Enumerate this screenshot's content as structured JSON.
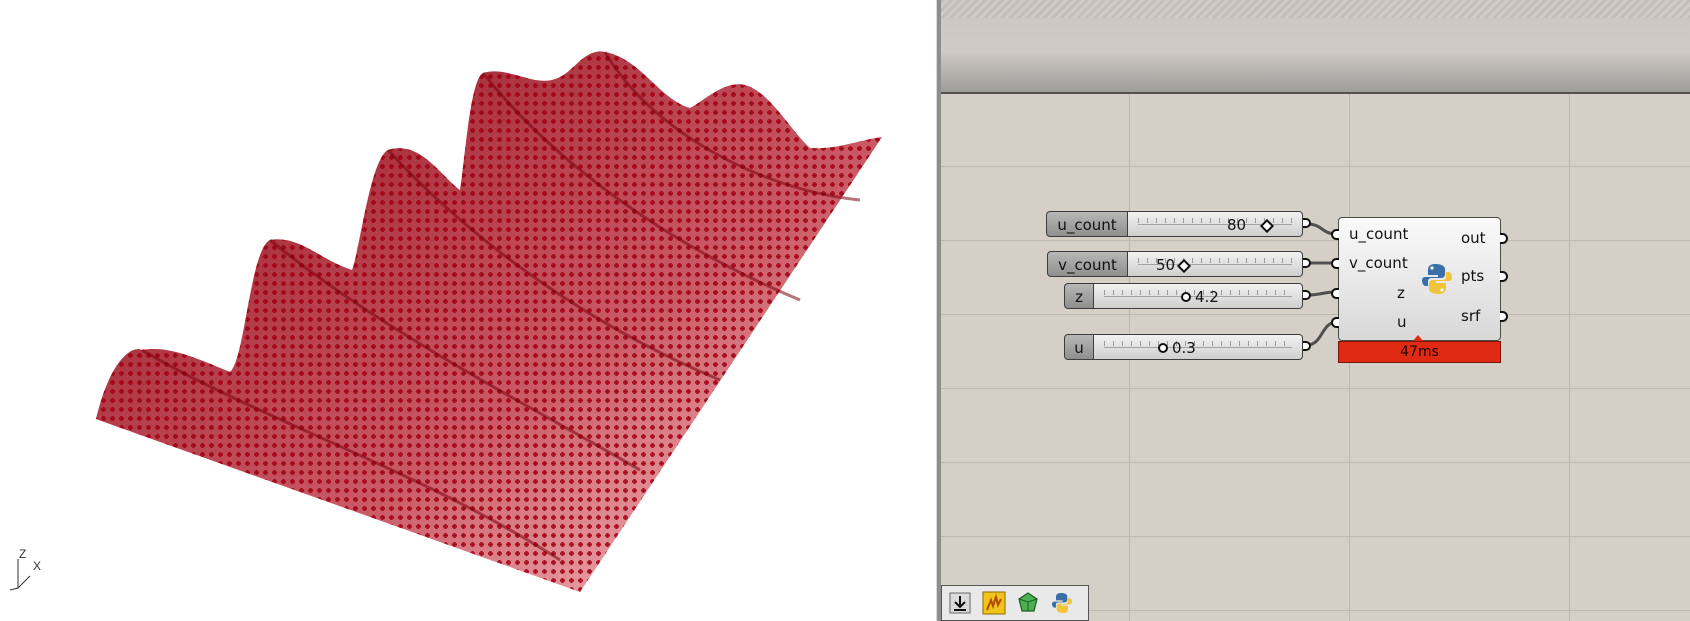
{
  "viewport": {
    "axis_labels": {
      "z": "Z",
      "x": "X"
    },
    "surface_colors": {
      "fill": "#f3b6bb",
      "points": "#a10012"
    }
  },
  "sliders": [
    {
      "name": "u_count",
      "value": "80",
      "grip": "diamond"
    },
    {
      "name": "v_count",
      "value": "50",
      "grip": "diamond"
    },
    {
      "name": "z",
      "value": "4.2",
      "grip": "circle"
    },
    {
      "name": "u",
      "value": "0.3",
      "grip": "circle"
    }
  ],
  "python_component": {
    "inputs": [
      "u_count",
      "v_count",
      "z",
      "u"
    ],
    "outputs": [
      "out",
      "pts",
      "srf"
    ],
    "icon": "python-icon",
    "timing": "47ms",
    "timing_color": "#e02a14"
  },
  "toolbar": {
    "buttons": [
      "download-icon",
      "preview-icon",
      "gem-icon",
      "python-icon"
    ]
  }
}
